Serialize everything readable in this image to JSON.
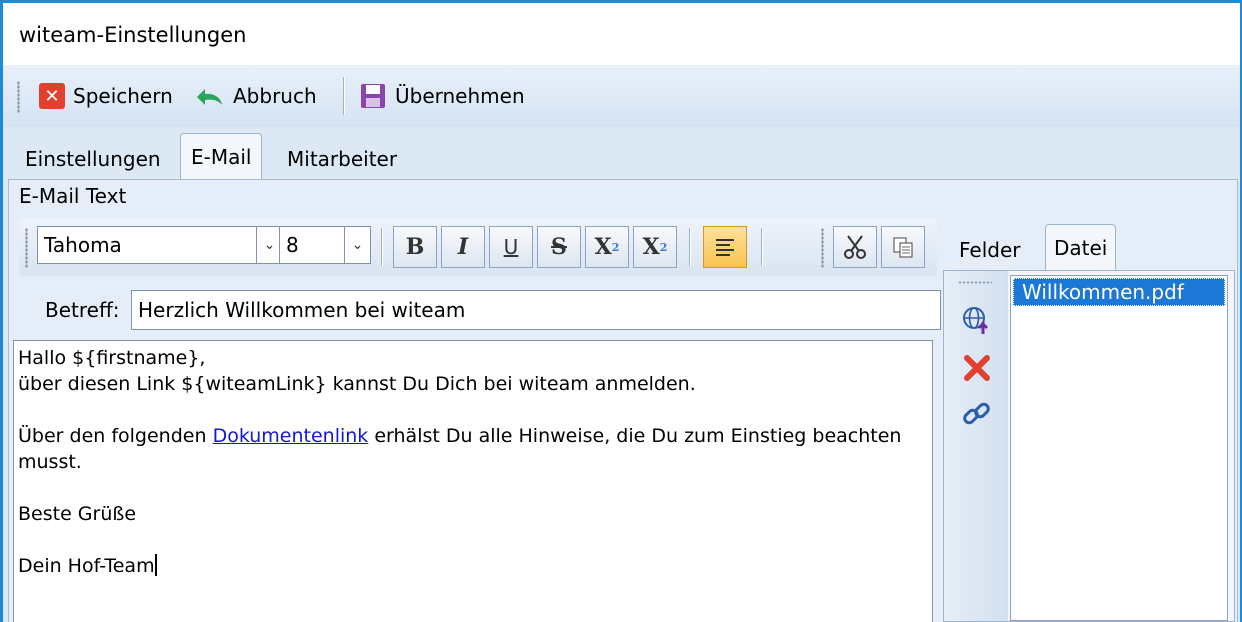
{
  "window": {
    "title": "witeam-Einstellungen"
  },
  "toolbar": {
    "save_label": "Speichern",
    "cancel_label": "Abbruch",
    "apply_label": "Übernehmen"
  },
  "tabs": [
    {
      "label": "Einstellungen",
      "active": false
    },
    {
      "label": "E-Mail",
      "active": true
    },
    {
      "label": "Mitarbeiter",
      "active": false
    }
  ],
  "email_panel": {
    "title": "E-Mail Text",
    "font_name": "Tahoma",
    "font_size": "8",
    "format_buttons": [
      "bold",
      "italic",
      "underline",
      "strikethrough",
      "subscript",
      "superscript",
      "align-left",
      "cut",
      "copy"
    ],
    "active_format": "align-left",
    "subject_label": "Betreff:",
    "subject_value": "Herzlich Willkommen bei witeam",
    "body": {
      "line1": "Hallo ${firstname},",
      "line2": "über diesen Link ${witeamLink} kannst Du Dich bei witeam anmelden.",
      "line3_before": "Über den folgenden ",
      "line3_link": "Dokumentenlink",
      "line3_after": " erhälst Du alle Hinweise, die Du zum Einstieg beachten musst.",
      "line4": "Beste Grüße",
      "line5": "Dein Hof-Team"
    }
  },
  "side_panel": {
    "tabs": [
      {
        "label": "Felder",
        "active": false
      },
      {
        "label": "Datei",
        "active": true
      }
    ],
    "files": [
      "Willkommen.pdf"
    ],
    "selected_file": "Willkommen.pdf"
  },
  "colors": {
    "accent": "#1c8ad8",
    "selection": "#1c78d6",
    "delete_red": "#e0402c",
    "link_blue": "#1515d6"
  }
}
